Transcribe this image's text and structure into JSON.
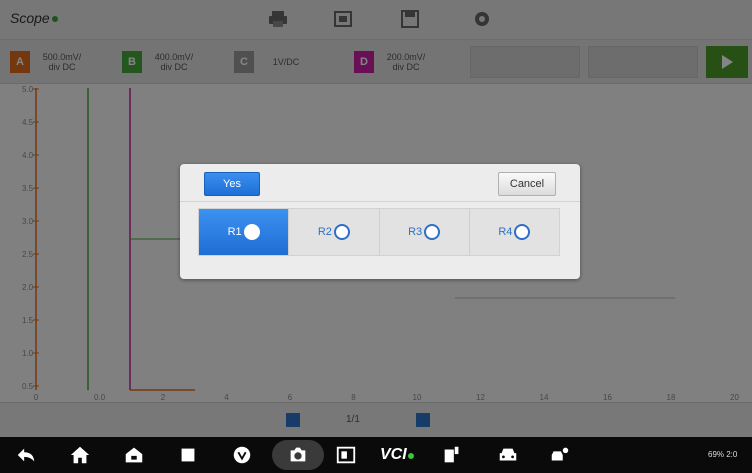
{
  "app": {
    "title": "Scope"
  },
  "toolbar": {
    "icons": [
      "print-icon",
      "record-icon",
      "save-icon",
      "settings-icon"
    ]
  },
  "channels": [
    {
      "tag": "A",
      "value": "500.0mV/ div DC",
      "color": "#e06a1c"
    },
    {
      "tag": "B",
      "value": "400.0mV/ div DC",
      "color": "#45a83a"
    },
    {
      "tag": "C",
      "value": "1V/DC",
      "color": "#9a9a9a"
    },
    {
      "tag": "D",
      "value": "200.0mV/ div DC",
      "color": "#c81ea5"
    }
  ],
  "plot": {
    "y_ticks": [
      "5.0",
      "4.5",
      "4.0",
      "3.5",
      "3.0",
      "2.5",
      "2.0",
      "1.5",
      "1.0",
      "0.5"
    ],
    "x_ticks": [
      "0",
      "0.0",
      "2",
      "4",
      "6",
      "8",
      "10",
      "12",
      "14",
      "16",
      "18",
      "20"
    ]
  },
  "bottom": {
    "page_indicator": "1/1"
  },
  "dialog": {
    "yes_label": "Yes",
    "cancel_label": "Cancel",
    "options": [
      {
        "label": "R1",
        "selected": true
      },
      {
        "label": "R2",
        "selected": false
      },
      {
        "label": "R3",
        "selected": false
      },
      {
        "label": "R4",
        "selected": false
      }
    ]
  },
  "navbar": {
    "vci_label": "VCI",
    "status": "69%  2:0"
  },
  "colors": {
    "accent": "#1e6fd6",
    "ok": "#4c9a2a"
  }
}
